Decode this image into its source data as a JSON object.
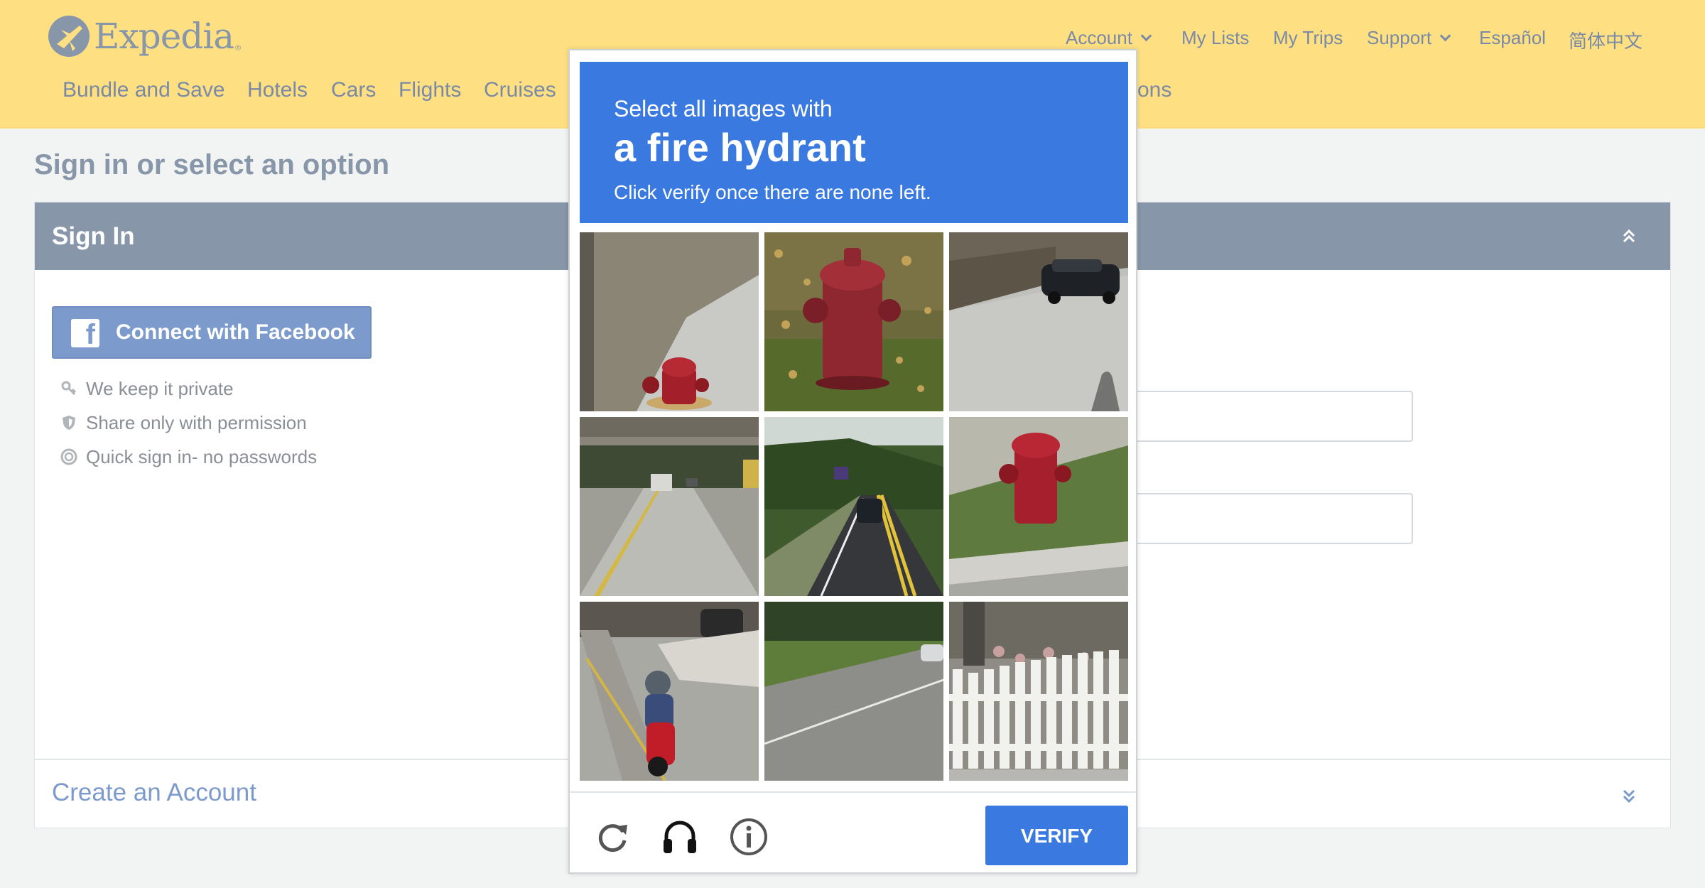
{
  "brand": {
    "name": "Expedia",
    "tm": "®"
  },
  "util_nav": {
    "account": "Account",
    "my_lists": "My Lists",
    "my_trips": "My Trips",
    "support": "Support",
    "espanol": "Español",
    "chinese": "简体中文"
  },
  "main_nav": {
    "bundle": "Bundle and Save",
    "hotels": "Hotels",
    "cars": "Cars",
    "flights": "Flights",
    "cruises": "Cruises",
    "partial": "ons"
  },
  "page": {
    "title": "Sign in or select an option",
    "signin_title": "Sign In",
    "facebook_label": "Connect with Facebook",
    "perks": [
      "We keep it private",
      "Share only with permission",
      "Quick sign in- no passwords"
    ],
    "create_account": "Create an Account"
  },
  "captcha": {
    "line1": "Select all images with",
    "line2": "a fire hydrant",
    "line3": "Click verify once there are none left.",
    "verify": "VERIFY",
    "tiles": [
      {
        "content": "fire hydrant near sidewalk"
      },
      {
        "content": "fire hydrant on grass with leaves"
      },
      {
        "content": "parked car near fence"
      },
      {
        "content": "road under overpass"
      },
      {
        "content": "car on wooded road"
      },
      {
        "content": "fire hydrant on grass near curb"
      },
      {
        "content": "motorcycle rider"
      },
      {
        "content": "empty road"
      },
      {
        "content": "white picket fence"
      }
    ]
  },
  "colors": {
    "header_bg": "#fee083",
    "nav_text": "#7a8aa6",
    "panel_head": "#8796a8",
    "facebook": "#7c9acb",
    "captcha_blue": "#3a7ae0"
  }
}
